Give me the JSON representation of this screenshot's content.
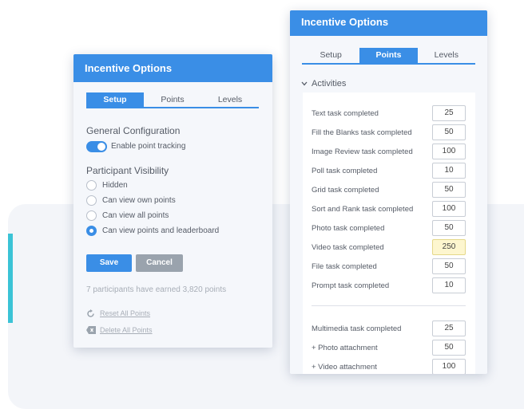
{
  "left_panel": {
    "title": "Incentive Options",
    "tabs": [
      {
        "label": "Setup",
        "active": true
      },
      {
        "label": "Points",
        "active": false
      },
      {
        "label": "Levels",
        "active": false
      }
    ],
    "general_title": "General Configuration",
    "toggle_label": "Enable point tracking",
    "toggle_on": true,
    "visibility_title": "Participant Visibility",
    "visibility_options": [
      {
        "label": "Hidden",
        "checked": false
      },
      {
        "label": "Can view own points",
        "checked": false
      },
      {
        "label": "Can view all points",
        "checked": false
      },
      {
        "label": "Can view points and leaderboard",
        "checked": true
      }
    ],
    "save_label": "Save",
    "cancel_label": "Cancel",
    "summary": "7 participants have earned 3,820 points",
    "reset_label": "Reset All Points",
    "delete_label": "Delete All Points"
  },
  "right_panel": {
    "title": "Incentive Options",
    "tabs": [
      {
        "label": "Setup",
        "active": false
      },
      {
        "label": "Points",
        "active": true
      },
      {
        "label": "Levels",
        "active": false
      }
    ],
    "section_label": "Activities",
    "activities": [
      {
        "label": "Text task completed",
        "value": "25"
      },
      {
        "label": "Fill the Blanks task completed",
        "value": "50"
      },
      {
        "label": "Image Review task completed",
        "value": "100"
      },
      {
        "label": "Poll task completed",
        "value": "10"
      },
      {
        "label": "Grid task completed",
        "value": "50"
      },
      {
        "label": "Sort and Rank task completed",
        "value": "100"
      },
      {
        "label": "Photo task completed",
        "value": "50"
      },
      {
        "label": "Video task completed",
        "value": "250",
        "highlight": true
      },
      {
        "label": "File task completed",
        "value": "50"
      },
      {
        "label": "Prompt task completed",
        "value": "10"
      }
    ],
    "multimedia": [
      {
        "label": "Multimedia task completed",
        "value": "25"
      },
      {
        "label": "+ Photo attachment",
        "value": "50"
      },
      {
        "label": "+ Video attachment",
        "value": "100"
      }
    ]
  },
  "colors": {
    "accent": "#3a8ee6",
    "teal_accent": "#3bc3d6",
    "highlight": "#fdf6cf"
  }
}
